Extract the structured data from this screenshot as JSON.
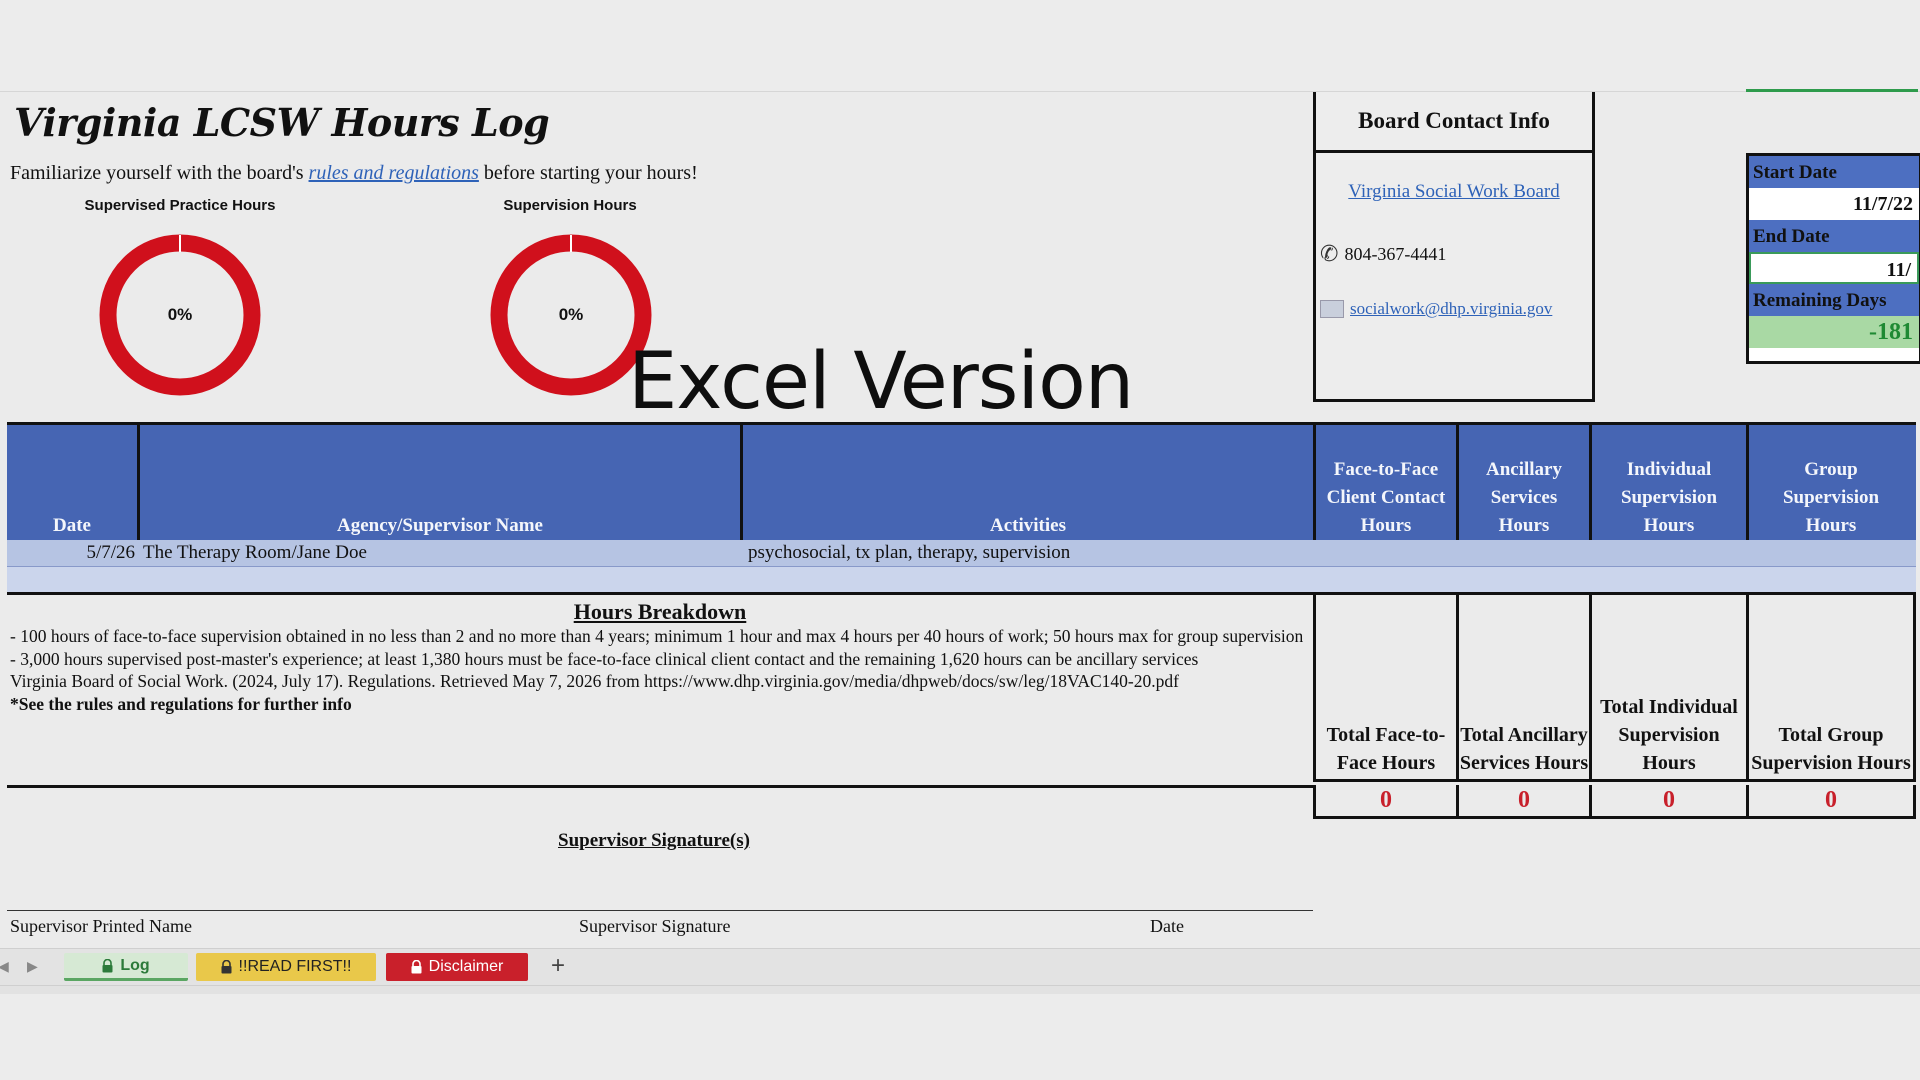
{
  "title": "Virginia LCSW Hours Log",
  "intro": {
    "before": "Familiarize yourself with the board's ",
    "link": "rules and regulations",
    "after": " before starting your hours!"
  },
  "charts": [
    {
      "title": "Supervised Practice Hours",
      "percent": "0%",
      "value": 0
    },
    {
      "title": "Supervision Hours",
      "percent": "0%",
      "value": 0
    }
  ],
  "watermark": "Excel Version",
  "board": {
    "heading": "Board Contact Info",
    "link": "Virginia Social Work Board",
    "phone": "804-367-4441",
    "email": "socialwork@dhp.virginia.gov"
  },
  "dates": {
    "start_label": "Start Date",
    "start_value": "11/7/22",
    "end_label": "End Date",
    "end_value": "11/",
    "remaining_label": "Remaining Days",
    "remaining_value": "-181"
  },
  "table": {
    "headers": {
      "date": "Date",
      "agency": "Agency/Supervisor Name",
      "activities": "Activities",
      "f2f": "Face-to-Face Client Contact Hours",
      "ancillary": "Ancillary Services Hours",
      "individual": "Individual Supervision Hours",
      "group": "Group Supervision Hours"
    },
    "rows": [
      {
        "date": "5/7/26",
        "agency": "The Therapy Room/Jane Doe",
        "activities": "psychosocial, tx plan, therapy, supervision"
      }
    ]
  },
  "breakdown": {
    "heading": "Hours Breakdown",
    "line1": "- 100 hours of face-to-face supervision obtained in no less than 2 and no more than 4 years; minimum 1 hour and max 4 hours per 40 hours of work; 50 hours max for group supervision",
    "line2": "- 3,000 hours supervised post-master's experience; at least 1,380 hours must be face-to-face clinical client contact and the remaining 1,620 hours can be ancillary services",
    "line3": "Virginia Board of Social Work. (2024, July 17). Regulations. Retrieved May 7, 2026 from https://www.dhp.virginia.gov/media/dhpweb/docs/sw/leg/18VAC140-20.pdf",
    "line4": "*See the rules and regulations for further info"
  },
  "totals": {
    "f2f_label": "Total Face-to-Face Hours",
    "ancillary_label": "Total Ancillary Services Hours",
    "individual_label": "Total Individual Supervision Hours",
    "group_label": "Total Group Supervision Hours",
    "f2f": "0",
    "ancillary": "0",
    "individual": "0",
    "group": "0"
  },
  "signature": {
    "heading": "Supervisor Signature(s)",
    "printed": "Supervisor Printed Name",
    "sign": "Supervisor Signature",
    "date": "Date"
  },
  "tabs": {
    "log": "Log",
    "read": "!!READ FIRST!!",
    "disclaimer": "Disclaimer",
    "add": "+"
  },
  "colors": {
    "header_blue": "#4665b3",
    "donut_red": "#d0101c",
    "total_red": "#c8202b",
    "remaining_green": "#a9d9a4"
  }
}
